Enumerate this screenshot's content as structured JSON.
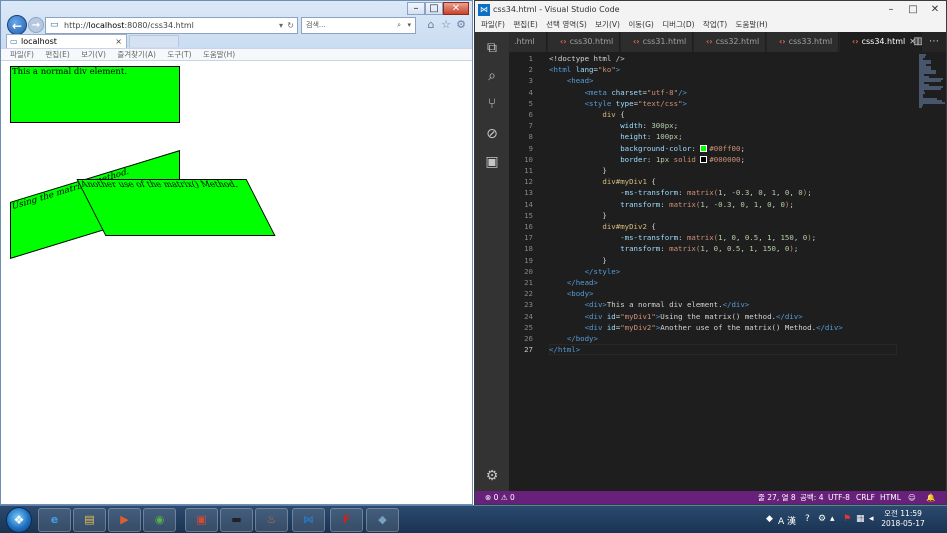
{
  "ie": {
    "address_prefix": "http://",
    "address_host": "localhost",
    "address_rest": ":8080/css34.html",
    "search_placeholder": "검색...",
    "tab_label": "localhost",
    "tab_close": "×",
    "menu": [
      "파일(F)",
      "편집(E)",
      "보기(V)",
      "즐겨찾기(A)",
      "도구(T)",
      "도움말(H)"
    ],
    "content": {
      "div1": "This a normal div element.",
      "div2": "Using the matrix() method.",
      "div3": "Another use of the matrix() Method."
    }
  },
  "vscode": {
    "title": "css34.html - Visual Studio Code",
    "menu": [
      "파일(F)",
      "편집(E)",
      "선택 영역(S)",
      "보기(V)",
      "이동(G)",
      "디버그(D)",
      "작업(T)",
      "도움말(H)"
    ],
    "tabs": [
      {
        "label": ".html",
        "active": false,
        "icon": false
      },
      {
        "label": "css30.html",
        "active": false,
        "icon": true
      },
      {
        "label": "css31.html",
        "active": false,
        "icon": true
      },
      {
        "label": "css32.html",
        "active": false,
        "icon": true
      },
      {
        "label": "css33.html",
        "active": false,
        "icon": true
      },
      {
        "label": "css34.html",
        "active": true,
        "icon": true
      }
    ],
    "current_line": 27,
    "code": [
      [
        [
          "t-txt",
          "<!doctype html />"
        ]
      ],
      [
        [
          "t-tag",
          "<html "
        ],
        [
          "t-attr",
          "lang"
        ],
        [
          "t-pun",
          "="
        ],
        [
          "t-str",
          "\"ko\""
        ],
        [
          "t-tag",
          ">"
        ]
      ],
      [
        [
          "t-txt",
          "    "
        ],
        [
          "t-tag",
          "<head>"
        ]
      ],
      [
        [
          "t-txt",
          "        "
        ],
        [
          "t-tag",
          "<meta "
        ],
        [
          "t-attr",
          "charset"
        ],
        [
          "t-pun",
          "="
        ],
        [
          "t-str",
          "\"utf-8\""
        ],
        [
          "t-tag",
          "/>"
        ]
      ],
      [
        [
          "t-txt",
          "        "
        ],
        [
          "t-tag",
          "<style "
        ],
        [
          "t-attr",
          "type"
        ],
        [
          "t-pun",
          "="
        ],
        [
          "t-str",
          "\"text/css\""
        ],
        [
          "t-tag",
          ">"
        ]
      ],
      [
        [
          "t-txt",
          "            "
        ],
        [
          "t-sel",
          "div"
        ],
        [
          "t-pun",
          " {"
        ]
      ],
      [
        [
          "t-txt",
          "                "
        ],
        [
          "t-prop",
          "width"
        ],
        [
          "t-pun",
          ": "
        ],
        [
          "t-val",
          "300px"
        ],
        [
          "t-pun",
          ";"
        ]
      ],
      [
        [
          "t-txt",
          "                "
        ],
        [
          "t-prop",
          "height"
        ],
        [
          "t-pun",
          ": "
        ],
        [
          "t-val",
          "100px"
        ],
        [
          "t-pun",
          ";"
        ]
      ],
      [
        [
          "t-txt",
          "                "
        ],
        [
          "t-prop",
          "background-color"
        ],
        [
          "t-pun",
          ": "
        ],
        [
          "sw-green",
          ""
        ],
        [
          "t-str",
          "#00ff00"
        ],
        [
          "t-pun",
          ";"
        ]
      ],
      [
        [
          "t-txt",
          "                "
        ],
        [
          "t-prop",
          "border"
        ],
        [
          "t-pun",
          ": "
        ],
        [
          "t-val",
          "1px"
        ],
        [
          "t-str",
          " solid "
        ],
        [
          "sw-black",
          ""
        ],
        [
          "t-str",
          "#000000"
        ],
        [
          "t-pun",
          ";"
        ]
      ],
      [
        [
          "t-txt",
          "            "
        ],
        [
          "t-pun",
          "}"
        ]
      ],
      [
        [
          "t-txt",
          "            "
        ],
        [
          "t-sel",
          "div#myDiv1"
        ],
        [
          "t-pun",
          " {"
        ]
      ],
      [
        [
          "t-txt",
          "                "
        ],
        [
          "t-prop",
          "-ms-transform"
        ],
        [
          "t-pun",
          ": "
        ],
        [
          "t-str",
          "matrix("
        ],
        [
          "t-val",
          "1"
        ],
        [
          "t-pun",
          ", "
        ],
        [
          "t-val",
          "-0.3"
        ],
        [
          "t-pun",
          ", "
        ],
        [
          "t-val",
          "0"
        ],
        [
          "t-pun",
          ", "
        ],
        [
          "t-val",
          "1"
        ],
        [
          "t-pun",
          ", "
        ],
        [
          "t-val",
          "0"
        ],
        [
          "t-pun",
          ", "
        ],
        [
          "t-val",
          "0"
        ],
        [
          "t-str",
          ")"
        ],
        [
          "t-pun",
          ";"
        ]
      ],
      [
        [
          "t-txt",
          "                "
        ],
        [
          "t-prop",
          "transform"
        ],
        [
          "t-pun",
          ": "
        ],
        [
          "t-str",
          "matrix("
        ],
        [
          "t-val",
          "1"
        ],
        [
          "t-pun",
          ", "
        ],
        [
          "t-val",
          "-0.3"
        ],
        [
          "t-pun",
          ", "
        ],
        [
          "t-val",
          "0"
        ],
        [
          "t-pun",
          ", "
        ],
        [
          "t-val",
          "1"
        ],
        [
          "t-pun",
          ", "
        ],
        [
          "t-val",
          "0"
        ],
        [
          "t-pun",
          ", "
        ],
        [
          "t-val",
          "0"
        ],
        [
          "t-str",
          ")"
        ],
        [
          "t-pun",
          ";"
        ]
      ],
      [
        [
          "t-txt",
          "            "
        ],
        [
          "t-pun",
          "}"
        ]
      ],
      [
        [
          "t-txt",
          "            "
        ],
        [
          "t-sel",
          "div#myDiv2"
        ],
        [
          "t-pun",
          " {"
        ]
      ],
      [
        [
          "t-txt",
          "                "
        ],
        [
          "t-prop",
          "-ms-transform"
        ],
        [
          "t-pun",
          ": "
        ],
        [
          "t-str",
          "matrix("
        ],
        [
          "t-val",
          "1"
        ],
        [
          "t-pun",
          ", "
        ],
        [
          "t-val",
          "0"
        ],
        [
          "t-pun",
          ", "
        ],
        [
          "t-val",
          "0.5"
        ],
        [
          "t-pun",
          ", "
        ],
        [
          "t-val",
          "1"
        ],
        [
          "t-pun",
          ", "
        ],
        [
          "t-val",
          "150"
        ],
        [
          "t-pun",
          ", "
        ],
        [
          "t-val",
          "0"
        ],
        [
          "t-str",
          ")"
        ],
        [
          "t-pun",
          ";"
        ]
      ],
      [
        [
          "t-txt",
          "                "
        ],
        [
          "t-prop",
          "transform"
        ],
        [
          "t-pun",
          ": "
        ],
        [
          "t-str",
          "matrix("
        ],
        [
          "t-val",
          "1"
        ],
        [
          "t-pun",
          ", "
        ],
        [
          "t-val",
          "0"
        ],
        [
          "t-pun",
          ", "
        ],
        [
          "t-val",
          "0.5"
        ],
        [
          "t-pun",
          ", "
        ],
        [
          "t-val",
          "1"
        ],
        [
          "t-pun",
          ", "
        ],
        [
          "t-val",
          "150"
        ],
        [
          "t-pun",
          ", "
        ],
        [
          "t-val",
          "0"
        ],
        [
          "t-str",
          ")"
        ],
        [
          "t-pun",
          ";"
        ]
      ],
      [
        [
          "t-txt",
          "            "
        ],
        [
          "t-pun",
          "}"
        ]
      ],
      [
        [
          "t-txt",
          "        "
        ],
        [
          "t-tag",
          "</style>"
        ]
      ],
      [
        [
          "t-txt",
          "    "
        ],
        [
          "t-tag",
          "</head>"
        ]
      ],
      [
        [
          "t-txt",
          "    "
        ],
        [
          "t-tag",
          "<body>"
        ]
      ],
      [
        [
          "t-txt",
          "        "
        ],
        [
          "t-tag",
          "<div>"
        ],
        [
          "t-txt",
          "This a normal div element."
        ],
        [
          "t-tag",
          "</div>"
        ]
      ],
      [
        [
          "t-txt",
          "        "
        ],
        [
          "t-tag",
          "<div "
        ],
        [
          "t-attr",
          "id"
        ],
        [
          "t-pun",
          "="
        ],
        [
          "t-str",
          "\"myDiv1\""
        ],
        [
          "t-tag",
          ">"
        ],
        [
          "t-txt",
          "Using the matrix() method."
        ],
        [
          "t-tag",
          "</div>"
        ]
      ],
      [
        [
          "t-txt",
          "        "
        ],
        [
          "t-tag",
          "<div "
        ],
        [
          "t-attr",
          "id"
        ],
        [
          "t-pun",
          "="
        ],
        [
          "t-str",
          "\"myDiv2\""
        ],
        [
          "t-tag",
          ">"
        ],
        [
          "t-txt",
          "Another use of the matrix() Method."
        ],
        [
          "t-tag",
          "</div>"
        ]
      ],
      [
        [
          "t-txt",
          "    "
        ],
        [
          "t-tag",
          "</body>"
        ]
      ],
      [
        [
          "t-tag",
          "</html>"
        ]
      ]
    ],
    "status": {
      "errors": "⊗ 0",
      "warnings": "⚠ 0",
      "position": "줄 27, 열 8",
      "spaces": "공백: 4",
      "encoding": "UTF-8",
      "eol": "CRLF",
      "language": "HTML",
      "smiley": "☺",
      "bell": "🔔"
    }
  },
  "taskbar": {
    "items": [
      "e",
      "▤",
      "▶",
      "◉",
      "▣",
      "▬",
      "♨",
      "⋈",
      "F",
      "◆"
    ],
    "tray_ime": "A 漢",
    "time": "오전 11:59",
    "date": "2018-05-17"
  },
  "colors": {
    "vscode_status": "#68217a",
    "demo_green": "#00ff00"
  }
}
